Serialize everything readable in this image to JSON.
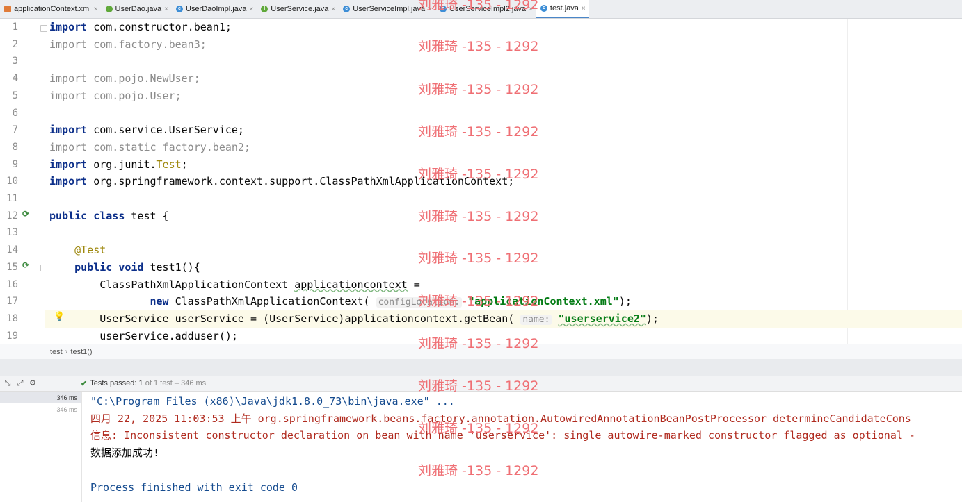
{
  "tabs": [
    {
      "label": "applicationContext.xml",
      "icon": "xml-file-icon",
      "kind": "xml",
      "active": false
    },
    {
      "label": "UserDao.java",
      "icon": "interface-icon",
      "kind": "iface",
      "active": false
    },
    {
      "label": "UserDaoImpl.java",
      "icon": "class-icon",
      "kind": "cls",
      "active": false
    },
    {
      "label": "UserService.java",
      "icon": "interface-icon",
      "kind": "iface",
      "active": false
    },
    {
      "label": "UserServiceImpl.java",
      "icon": "class-icon",
      "kind": "cls",
      "active": false
    },
    {
      "label": "UserServiceImpl2.java",
      "icon": "class-icon",
      "kind": "cls",
      "active": false
    },
    {
      "label": "test.java",
      "icon": "class-icon",
      "kind": "cls",
      "active": true
    }
  ],
  "tab_close": "×",
  "code_lines": [
    {
      "n": "1",
      "text": "import com.constructor.bean1;"
    },
    {
      "n": "2",
      "text": "import com.factory.bean3;"
    },
    {
      "n": "3",
      "text": ""
    },
    {
      "n": "4",
      "text": "import com.pojo.NewUser;"
    },
    {
      "n": "5",
      "text": "import com.pojo.User;"
    },
    {
      "n": "6",
      "text": ""
    },
    {
      "n": "7",
      "text": "import com.service.UserService;"
    },
    {
      "n": "8",
      "text": "import com.static_factory.bean2;"
    },
    {
      "n": "9",
      "text": "import org.junit.Test;"
    },
    {
      "n": "10",
      "text": "import org.springframework.context.support.ClassPathXmlApplicationContext;"
    },
    {
      "n": "11",
      "text": ""
    },
    {
      "n": "12",
      "text": "public class test {"
    },
    {
      "n": "13",
      "text": ""
    },
    {
      "n": "14",
      "text": "    @Test"
    },
    {
      "n": "15",
      "text": "    public void test1(){"
    },
    {
      "n": "16",
      "text": "        ClassPathXmlApplicationContext applicationcontext ="
    },
    {
      "n": "17",
      "text": "                new ClassPathXmlApplicationContext( configLocation: \"applicationContext.xml\");"
    },
    {
      "n": "18",
      "text": "        UserService userService = (UserService)applicationcontext.getBean( name: \"userservice2\");"
    },
    {
      "n": "19",
      "text": "        userService.adduser();"
    }
  ],
  "code": {
    "l1": {
      "kw": "import",
      "rest": " com.constructor.bean1;"
    },
    "l2": {
      "kw": "import",
      "rest": " com.factory.bean3;"
    },
    "l4": {
      "kw": "import",
      "rest": " com.pojo.NewUser;"
    },
    "l5": {
      "kw": "import",
      "rest": " com.pojo.User;"
    },
    "l7": {
      "kw": "import",
      "rest": " com.service.UserService;"
    },
    "l8": {
      "kw": "import",
      "rest": " com.static_factory.bean2;"
    },
    "l9": {
      "kw": "import",
      "pre": " org.junit.",
      "ann": "Test",
      "post": ";"
    },
    "l10": {
      "kw": "import",
      "rest": " org.springframework.context.support.ClassPathXmlApplicationContext;"
    },
    "l12": {
      "kw1": "public",
      "kw2": "class",
      "rest": " test {"
    },
    "l14": {
      "ann": "@Test"
    },
    "l15": {
      "kw1": "public",
      "kw2": "void",
      "rest": " test1(){"
    },
    "l16": {
      "type": "ClassPathXmlApplicationContext ",
      "var": "applicationcontext",
      "rest": " ="
    },
    "l17": {
      "kw": "new",
      "pre": " ClassPathXmlApplicationContext( ",
      "hint": "configLocation:",
      "str": "\"applicationContext.xml\"",
      "post": ");"
    },
    "l18": {
      "pre": "UserService userService = (UserService)applicationcontext.getBean( ",
      "hint": "name:",
      "str": "\"userservice2\"",
      "post": ");"
    },
    "l19": {
      "text": "userService.adduser();"
    }
  },
  "breadcrumb": {
    "items": [
      "test",
      "test1()"
    ],
    "sep": "›"
  },
  "run": {
    "status_label": "Tests passed:",
    "status_count": "1",
    "status_detail": "of 1 test – 346 ms",
    "timing_primary": "346 ms",
    "timing_secondary": "346 ms"
  },
  "console_lines": [
    {
      "text": "\"C:\\Program Files (x86)\\Java\\jdk1.8.0_73\\bin\\java.exe\" ...",
      "style": "c-path"
    },
    {
      "text": "四月 22, 2025 11:03:53 上午 org.springframework.beans.factory.annotation.AutowiredAnnotationBeanPostProcessor determineCandidateCons",
      "style": "c-err"
    },
    {
      "text": "信息: Inconsistent constructor declaration on bean with name 'userservice': single autowire-marked constructor flagged as optional -",
      "style": "c-err"
    },
    {
      "text": "数据添加成功!",
      "style": "c-norm"
    },
    {
      "text": "",
      "style": "c-norm"
    },
    {
      "text": "Process finished with exit code 0",
      "style": "c-exit"
    }
  ],
  "watermark": "刘雅琦 -135 - 1292",
  "colors": {
    "keyword": "#0c2f8a",
    "string": "#067d17",
    "annotation": "#9e880d",
    "error": "#b02a1e",
    "watermark": "#ef6f74",
    "passed": "#3c8a3e"
  }
}
